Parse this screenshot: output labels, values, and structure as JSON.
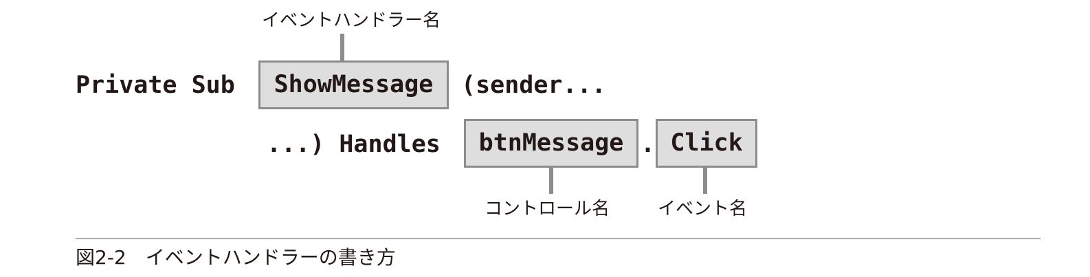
{
  "diagram": {
    "line1": {
      "prefix": "Private Sub",
      "handler_name": "ShowMessage",
      "suffix": "(sender..."
    },
    "line2": {
      "prefix": "...) Handles",
      "control_name": "btnMessage",
      "separator": ".",
      "event_name": "Click"
    },
    "labels": {
      "handler_name": "イベントハンドラー名",
      "control_name": "コントロール名",
      "event_name": "イベント名"
    },
    "colors": {
      "box_fill": "#dedede",
      "box_border": "#8c8c8c",
      "connector": "#8c8c8c",
      "text": "#231815"
    }
  },
  "caption": {
    "figure_number": "図2-2",
    "text": "イベントハンドラーの書き方"
  }
}
